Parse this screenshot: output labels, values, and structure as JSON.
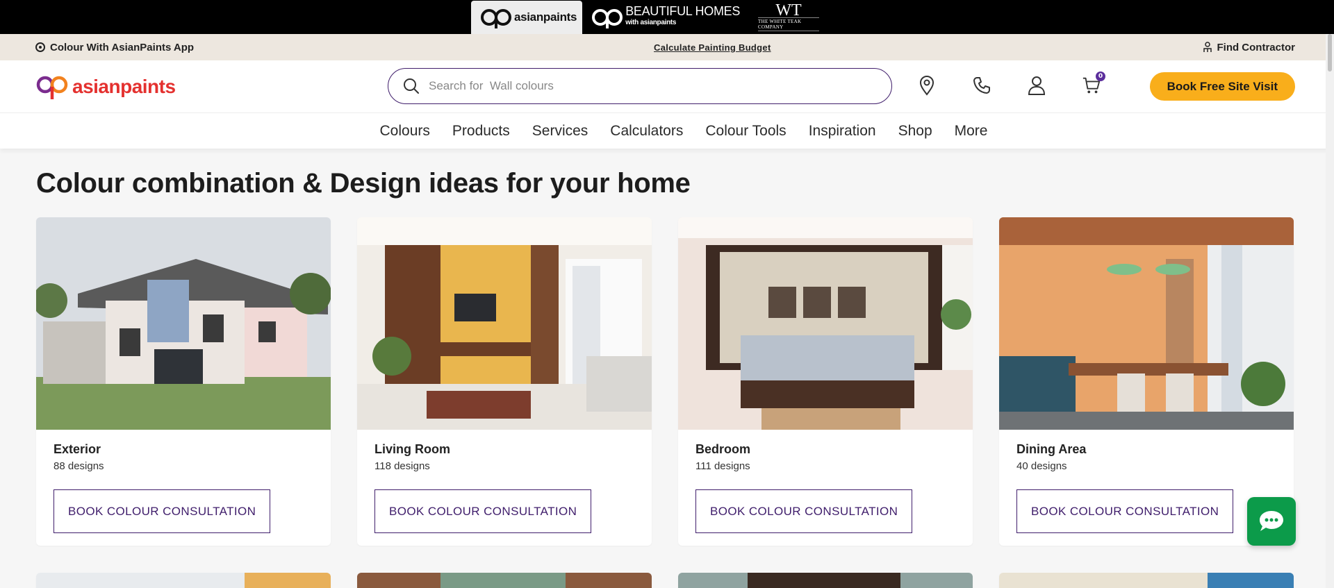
{
  "brand_strip": {
    "brands": [
      {
        "name": "asianpaints"
      },
      {
        "name": "BEAUTIFUL HOMES",
        "sub": "with asianpaints"
      },
      {
        "mono": "WT",
        "name": "THE WHITE TEAK COMPANY"
      }
    ]
  },
  "util_bar": {
    "app_link": "Colour With AsianPaints App",
    "budget_link": "Calculate Painting Budget",
    "contractor_link": "Find Contractor"
  },
  "header": {
    "logo_text": "asianpaints",
    "search_placeholder": "Search for  Wall colours",
    "cart_count": "0",
    "cta_label": "Book Free Site Visit",
    "icons": [
      "location-icon",
      "phone-icon",
      "user-icon",
      "cart-icon"
    ]
  },
  "nav": {
    "items": [
      "Colours",
      "Products",
      "Services",
      "Calculators",
      "Colour Tools",
      "Inspiration",
      "Shop",
      "More"
    ]
  },
  "main": {
    "title": "Colour combination & Design ideas for your home",
    "cards": [
      {
        "title": "Exterior",
        "count": "88 designs",
        "button": "BOOK COLOUR CONSULTATION"
      },
      {
        "title": "Living Room",
        "count": "118 designs",
        "button": "BOOK COLOUR CONSULTATION"
      },
      {
        "title": "Bedroom",
        "count": "111 designs",
        "button": "BOOK COLOUR CONSULTATION"
      },
      {
        "title": "Dining Area",
        "count": "40 designs",
        "button": "BOOK COLOUR CONSULTATION"
      }
    ]
  },
  "colors": {
    "accent_purple": "#3f1d6b",
    "cta_yellow": "#f9ae1b",
    "brand_red": "#e4312f",
    "chat_green": "#0c9b4a",
    "util_bg": "#ede7df"
  }
}
